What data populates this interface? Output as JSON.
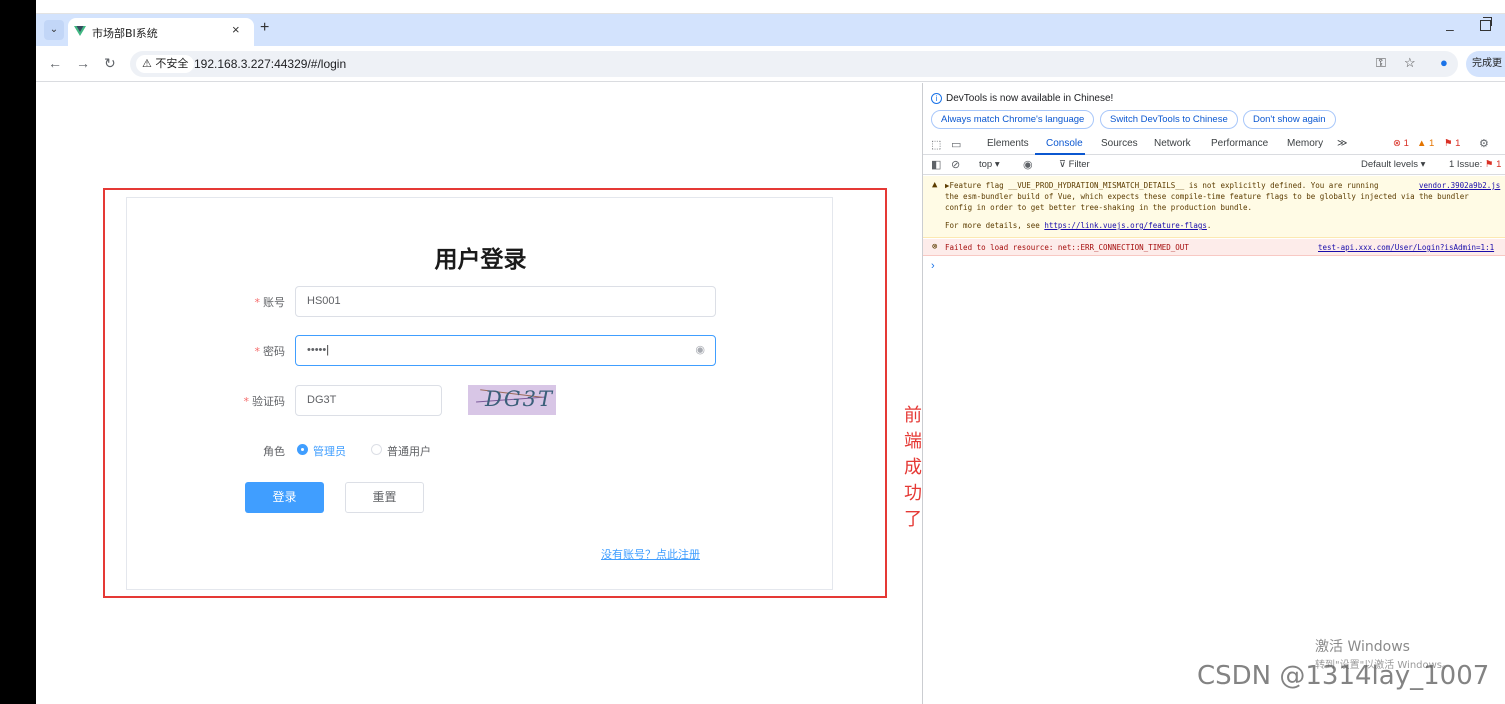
{
  "browser": {
    "tab_title": "市场部BI系统",
    "tab_close": "×",
    "new_tab": "+",
    "minimize": "–",
    "security_label": "⚠ 不安全",
    "url": "192.168.3.227:44329/#/login",
    "finish_button": "完成更"
  },
  "login": {
    "title": "用户登录",
    "required_mark": "*",
    "account_label": "账号",
    "account_value": "HS001",
    "password_label": "密码",
    "password_value": "•••••",
    "captcha_label": "验证码",
    "captcha_value": "DG3T",
    "captcha_image_text": "DG3T",
    "role_label": "角色",
    "role_options": [
      "管理员",
      "普通用户"
    ],
    "role_selected": "管理员",
    "login_button": "登录",
    "reset_button": "重置",
    "register_link": "没有账号？点此注册"
  },
  "annotation": "前端成功了",
  "devtools": {
    "notice": "DevTools is now available in Chinese!",
    "pills": [
      "Always match Chrome's language",
      "Switch DevTools to Chinese",
      "Don't show again"
    ],
    "tabs": [
      "Elements",
      "Console",
      "Sources",
      "Network",
      "Performance",
      "Memory",
      "≫"
    ],
    "active_tab": "Console",
    "error_count": "1",
    "warning_count": "1",
    "issue_flag_count": "1",
    "context": "top ▾",
    "filter_placeholder": "Filter",
    "levels": "Default levels ▾",
    "issues": "1 Issue:",
    "issues_count": "1",
    "warning_line1": "▶Feature flag __VUE_PROD_HYDRATION_MISMATCH_DETAILS__ is not explicitly defined. You are running",
    "warning_source": "vendor.3902a9b2.js",
    "warning_line2": "the esm-bundler build of Vue, which expects these compile-time feature flags to be globally injected via the bundler",
    "warning_line3": "config in order to get better tree-shaking in the production bundle.",
    "warning_line4_prefix": "For more details, see",
    "warning_link": "https://link.vuejs.org/feature-flags",
    "error_text": "Failed to load resource: net::ERR_CONNECTION_TIMED_OUT",
    "error_source": "test-api.xxx.com/User/Login?isAdmin=1:1",
    "prompt": "›"
  },
  "overlay": {
    "windows_activate": "激活 Windows",
    "windows_activate_sub": "转到\"设置\"以激活 Windows。",
    "csdn_watermark": "CSDN @1314lay_1007"
  }
}
